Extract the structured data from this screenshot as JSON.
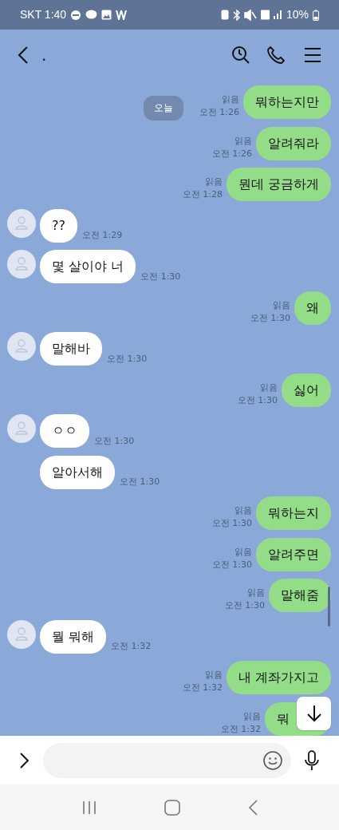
{
  "status_bar": {
    "carrier_time": "SKT 1:40",
    "battery": "10%"
  },
  "header": {
    "title": "."
  },
  "messages": [
    {
      "kind": "sent",
      "text": "뭐하는지만",
      "read": "읽음",
      "time": "오전 1:26",
      "date_chip": "오늘"
    },
    {
      "kind": "sent",
      "text": "알려줘라",
      "read": "읽음",
      "time": "오전 1:26"
    },
    {
      "kind": "sent",
      "text": "뭔데 궁금하게",
      "read": "읽음",
      "time": "오전 1:28"
    },
    {
      "kind": "received",
      "text": "??",
      "time": "오전 1:29",
      "avatar": true
    },
    {
      "kind": "received",
      "text": "몇 살이야 너",
      "time": "오전 1:30",
      "avatar": true
    },
    {
      "kind": "sent",
      "text": "왜",
      "read": "읽음",
      "time": "오전 1:30"
    },
    {
      "kind": "received",
      "text": "말해바",
      "time": "오전 1:30",
      "avatar": true
    },
    {
      "kind": "sent",
      "text": "싫어",
      "read": "읽음",
      "time": "오전 1:30"
    },
    {
      "kind": "received",
      "text": "ㅇㅇ",
      "time": "오전 1:30",
      "avatar": true
    },
    {
      "kind": "received",
      "text": "알아서해",
      "time": "오전 1:30",
      "avatar": false
    },
    {
      "kind": "sent",
      "text": "뭐하는지",
      "read": "읽음",
      "time": "오전 1:30"
    },
    {
      "kind": "sent",
      "text": "알려주면",
      "read": "읽음",
      "time": "오전 1:30"
    },
    {
      "kind": "sent",
      "text": "말해줌",
      "read": "읽음",
      "time": "오전 1:30"
    },
    {
      "kind": "received",
      "text": "뭘 뭐해",
      "time": "오전 1:32",
      "avatar": true
    },
    {
      "kind": "sent",
      "text": "내 계좌가지고",
      "read": "읽음",
      "time": "오전 1:32"
    },
    {
      "kind": "sent",
      "text": "뭐",
      "read": "읽음",
      "time": "오전 1:32",
      "covered": true
    }
  ]
}
